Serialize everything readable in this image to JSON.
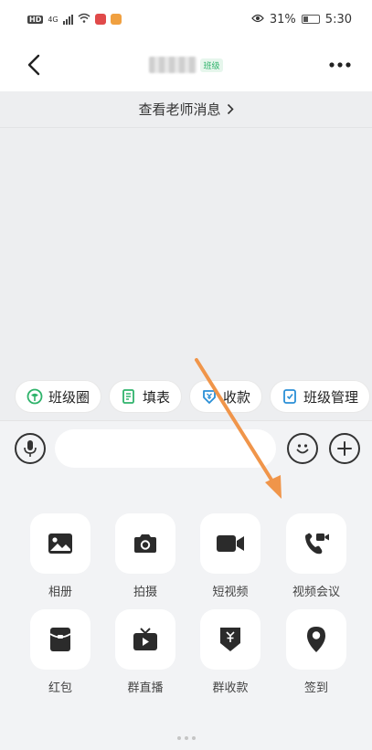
{
  "status_bar": {
    "left": {
      "hd": "HD",
      "net": "4G"
    },
    "battery": "31%",
    "time": "5:30",
    "battery_level": 0.31
  },
  "header": {
    "title_tag": "班级",
    "back_icon": "chevron-left-icon",
    "more_icon": "ellipsis-icon"
  },
  "chat": {
    "teacher_link": "查看老师消息",
    "teacher_link_icon": "chevron-right-icon"
  },
  "quick_actions": [
    {
      "label": "班级圈",
      "icon": "class-circle-icon",
      "color": "#2fb36b"
    },
    {
      "label": "填表",
      "icon": "form-icon",
      "color": "#2fb36b"
    },
    {
      "label": "收款",
      "icon": "payment-icon",
      "color": "#2a8fd6"
    },
    {
      "label": "班级管理",
      "icon": "class-manage-icon",
      "color": "#2a8fd6"
    }
  ],
  "input_bar": {
    "voice_icon": "microphone-icon",
    "emoji_icon": "emoji-icon",
    "plus_icon": "plus-icon",
    "text_value": ""
  },
  "panel": {
    "items": [
      {
        "label": "相册",
        "icon": "album-icon"
      },
      {
        "label": "拍摄",
        "icon": "camera-icon"
      },
      {
        "label": "短视频",
        "icon": "video-icon"
      },
      {
        "label": "视频会议",
        "icon": "video-call-icon"
      },
      {
        "label": "红包",
        "icon": "red-packet-icon"
      },
      {
        "label": "群直播",
        "icon": "live-tv-icon"
      },
      {
        "label": "群收款",
        "icon": "group-collect-icon"
      },
      {
        "label": "签到",
        "icon": "location-pin-icon"
      }
    ],
    "page_dots": 3
  },
  "colors": {
    "accent_green": "#2fb36b",
    "annotation_arrow": "#f0954a",
    "chat_bg": "#edeef0",
    "panel_bg": "#f2f3f5"
  }
}
